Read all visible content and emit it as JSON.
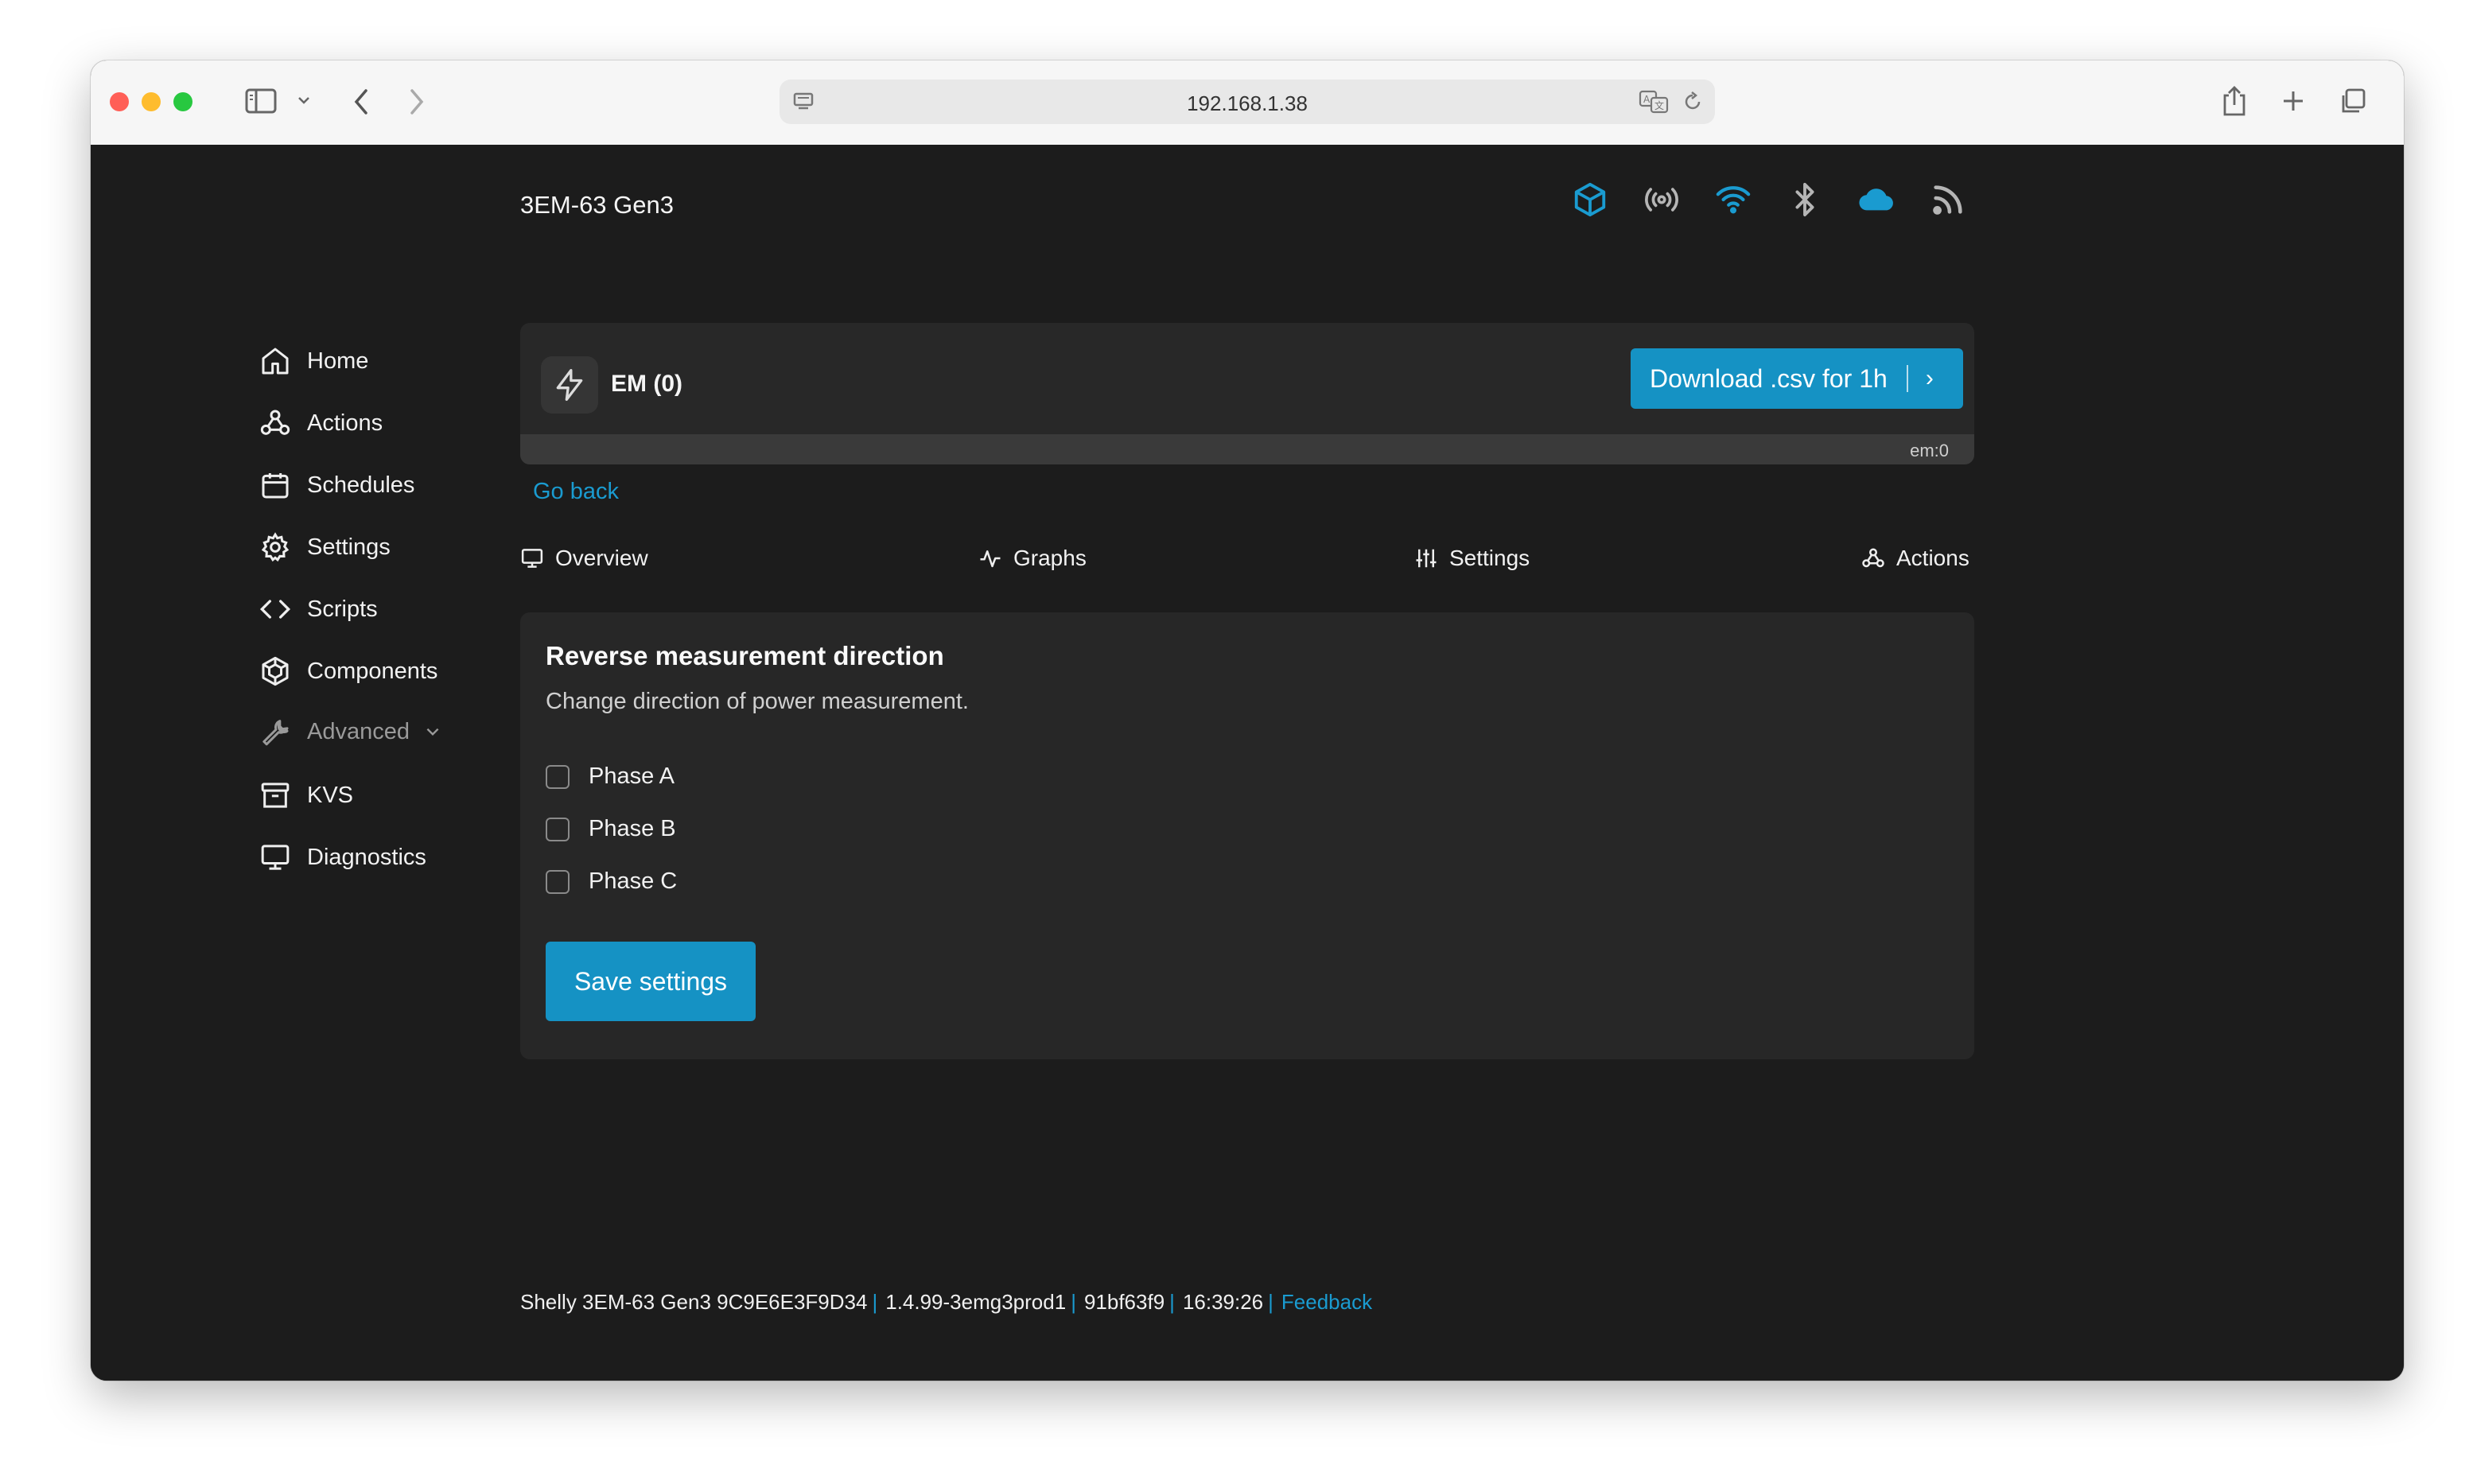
{
  "browser": {
    "url": "192.168.1.38"
  },
  "sidebar": {
    "items": [
      {
        "label": "Home",
        "icon": "home-icon"
      },
      {
        "label": "Actions",
        "icon": "webhook-icon"
      },
      {
        "label": "Schedules",
        "icon": "calendar-icon"
      },
      {
        "label": "Settings",
        "icon": "gear-icon"
      },
      {
        "label": "Scripts",
        "icon": "code-icon"
      },
      {
        "label": "Components",
        "icon": "components-icon"
      },
      {
        "label": "Advanced",
        "icon": "wrench-icon"
      },
      {
        "label": "KVS",
        "icon": "archive-icon"
      },
      {
        "label": "Diagnostics",
        "icon": "monitor-icon"
      }
    ]
  },
  "header": {
    "device_title": "3EM-63 Gen3",
    "status_icons": [
      "package-icon",
      "broadcast-icon",
      "wifi-icon",
      "bluetooth-icon",
      "cloud-icon",
      "rss-icon"
    ]
  },
  "em_card": {
    "label": "EM (0)",
    "download_label": "Download .csv for 1h",
    "download_chevron": "›",
    "component_id": "em:0"
  },
  "go_back": "Go back",
  "tabs": [
    {
      "label": "Overview",
      "icon": "monitor-icon"
    },
    {
      "label": "Graphs",
      "icon": "activity-icon"
    },
    {
      "label": "Settings",
      "icon": "sliders-icon"
    },
    {
      "label": "Actions",
      "icon": "webhook-icon"
    }
  ],
  "settings_card": {
    "title": "Reverse measurement direction",
    "description": "Change direction of power measurement.",
    "phases": [
      {
        "label": "Phase A",
        "checked": false
      },
      {
        "label": "Phase B",
        "checked": false
      },
      {
        "label": "Phase C",
        "checked": false
      }
    ],
    "save_label": "Save settings"
  },
  "footer": {
    "device_info": "Shelly 3EM-63 Gen3 9C9E6E3F9D34",
    "firmware": "1.4.99-3emg3prod1",
    "build": "91bf63f9",
    "time": "16:39:26",
    "separator": "|",
    "feedback": "Feedback"
  },
  "colors": {
    "accent": "#1592c4",
    "link": "#1a9bd0",
    "background": "#1c1c1c",
    "card": "#282828"
  }
}
